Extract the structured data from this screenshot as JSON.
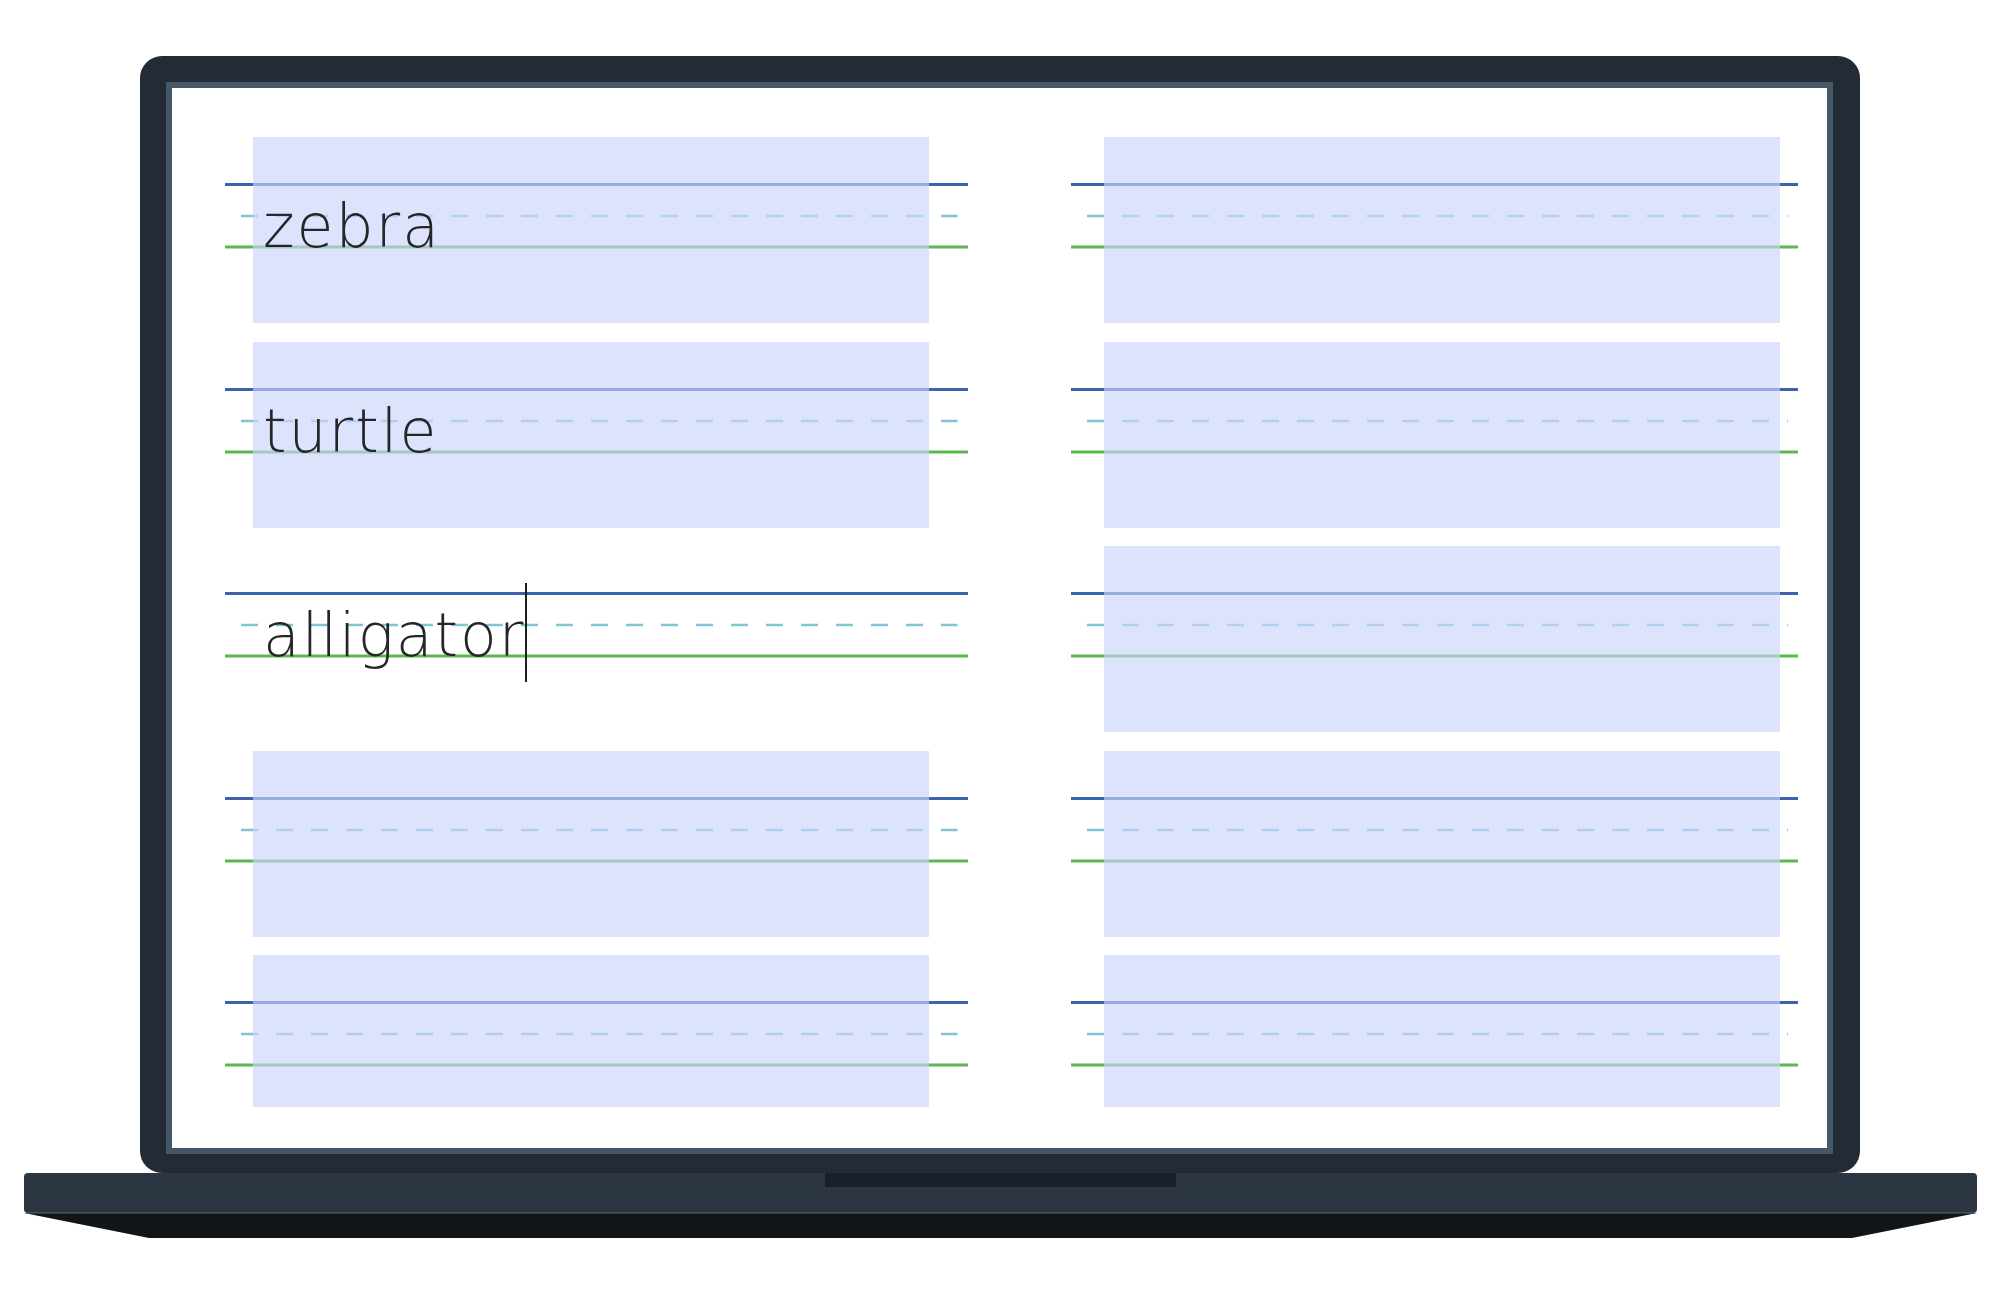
{
  "worksheet": {
    "columns": [
      {
        "lines": [
          {
            "text": "zebra",
            "focused": false
          },
          {
            "text": "turtle",
            "focused": false
          },
          {
            "text": "alligator",
            "focused": true
          },
          {
            "focused": false
          },
          {
            "focused": false
          }
        ]
      },
      {
        "lines": [
          {
            "focused": false
          },
          {
            "focused": false
          },
          {
            "focused": false
          },
          {
            "focused": false
          },
          {
            "focused": false
          }
        ]
      }
    ]
  }
}
